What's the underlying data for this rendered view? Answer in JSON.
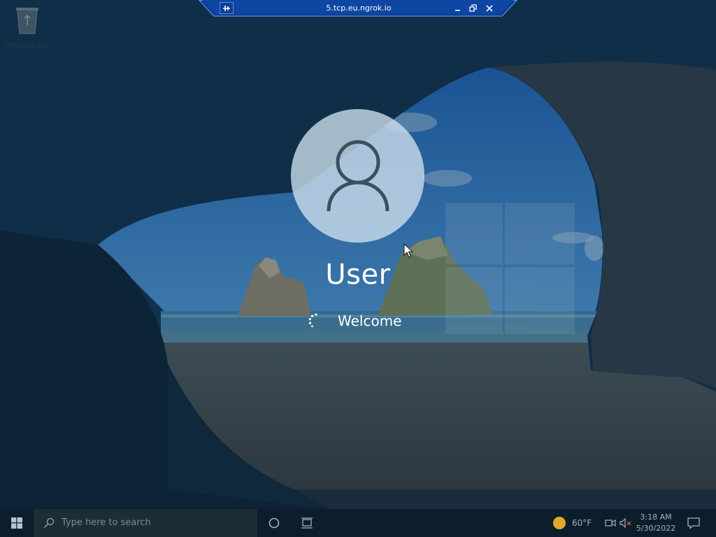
{
  "remote_session": {
    "host": "5.tcp.eu.ngrok.io"
  },
  "desktop": {
    "icons": [
      {
        "label": "Recycle Bin",
        "icon": "recycle-bin-icon"
      }
    ]
  },
  "login": {
    "username": "User",
    "status": "Welcome",
    "avatar_icon": "user-silhouette-icon"
  },
  "taskbar": {
    "search_placeholder": "Type here to search",
    "weather": {
      "temperature": "60°F",
      "icon": "sunny-icon"
    },
    "clock": {
      "time": "3:18 AM",
      "date": "5/30/2022"
    },
    "tray_icons": [
      "camera-icon",
      "speaker-muted-icon",
      "notification-icon"
    ]
  },
  "colors": {
    "taskbar_bg": "#0c1e2c",
    "connection_bar": "#0a3f97",
    "avatar_bg": "#d0e1ed"
  }
}
